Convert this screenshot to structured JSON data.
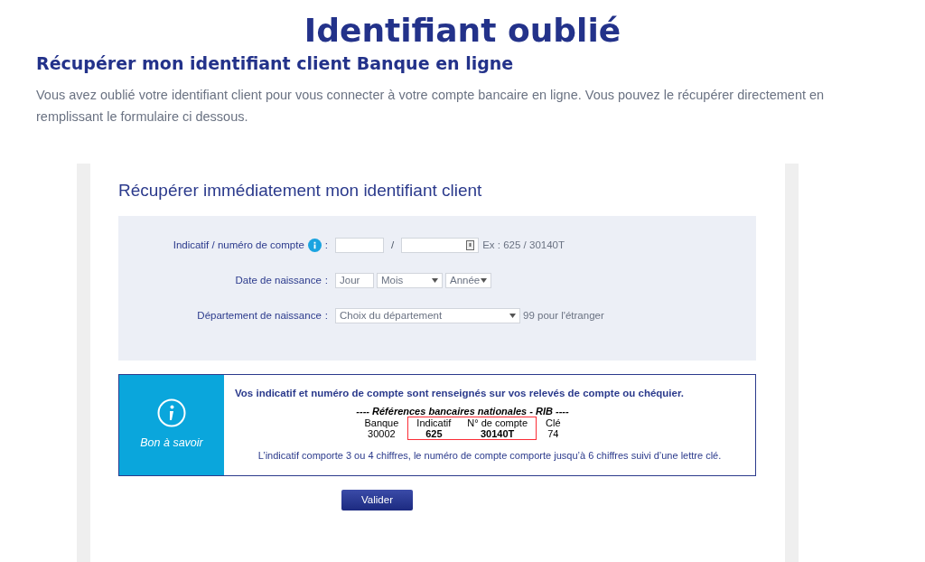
{
  "page_title": "Identifiant oublié",
  "subtitle": "Récupérer mon identifiant client Banque en ligne",
  "intro": "Vous avez oublié votre identifiant client pour vous connecter à votre compte bancaire en ligne. Vous pouvez le récupérer directement en remplissant le formulaire ci dessous.",
  "form": {
    "title": "Récupérer immédiatement mon identifiant client",
    "rows": [
      {
        "kind": "account",
        "label": "Indicatif / numéro de compte",
        "colon": ":",
        "info_icon": true,
        "separator": "/",
        "hint": "Ex : 625 / 30140T"
      },
      {
        "kind": "date",
        "label": "Date de naissance",
        "colon": ":",
        "day_placeholder": "Jour",
        "month_value": "Mois",
        "year_value": "Année"
      },
      {
        "kind": "department",
        "label": "Département de naissance",
        "colon": ":",
        "value": "Choix du département",
        "hint": "99 pour l'étranger"
      }
    ]
  },
  "info_box": {
    "badge": "Bon à savoir",
    "headline": "Vos indicatif et numéro de compte sont renseignés sur vos relevés de compte ou chéquier.",
    "rib_title": "---- Références bancaires nationales - RIB ----",
    "rib_columns": [
      {
        "heading": "Banque",
        "value": "30002",
        "highlighted": false
      },
      {
        "heading": "Indicatif",
        "value": "625",
        "highlighted": true
      },
      {
        "heading": "N° de compte",
        "value": "30140T",
        "highlighted": true
      },
      {
        "heading": "Clé",
        "value": "74",
        "highlighted": false
      }
    ],
    "note": "L’indicatif comporte 3 ou 4 chiffres, le numéro de compte comporte jusqu’à 6 chiffres suivi d’une lettre clé."
  },
  "submit": "Valider"
}
